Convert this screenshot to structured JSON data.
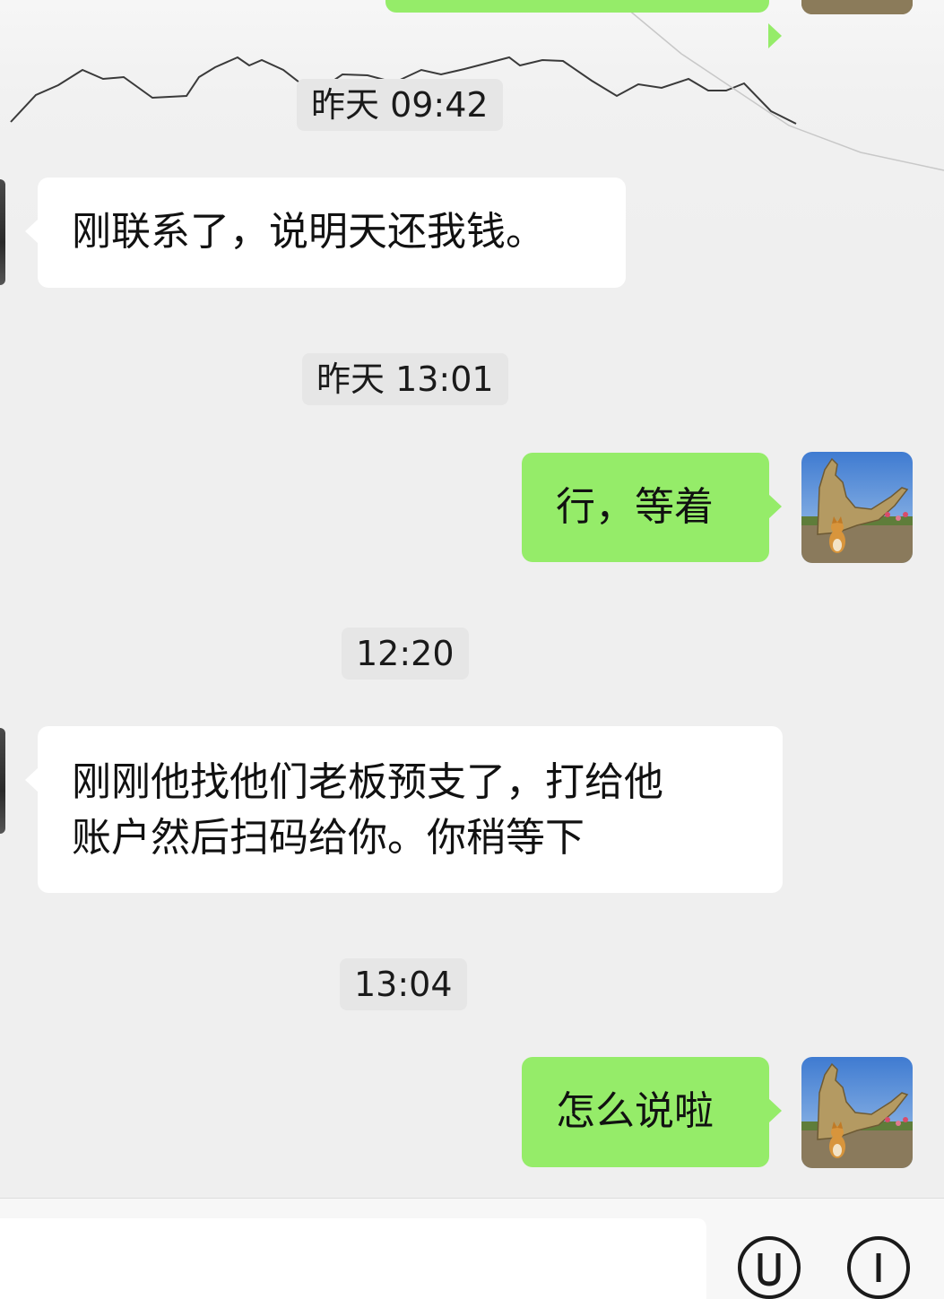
{
  "chat": {
    "timestamps": [
      "昨天 09:42",
      "昨天 13:01",
      "12:20",
      "13:04"
    ],
    "messages": [
      {
        "side": "incoming",
        "text": "刚联系了，说明天还我钱。"
      },
      {
        "side": "outgoing",
        "text": "行，等着"
      },
      {
        "side": "incoming",
        "line1": "刚刚他找他们老板预支了，打给他",
        "line2": "账户然后扫码给你。你稍等下"
      },
      {
        "side": "outgoing",
        "text": "怎么说啦"
      }
    ]
  },
  "input_bar": {
    "input_value": "",
    "voice_icon": "voice-circle-icon",
    "emoji_icon": "emoji-circle-icon"
  },
  "colors": {
    "background": "#efefef",
    "incoming_bubble": "#ffffff",
    "outgoing_bubble": "#95ec69",
    "timestamp_bg": "#e6e6e6"
  }
}
